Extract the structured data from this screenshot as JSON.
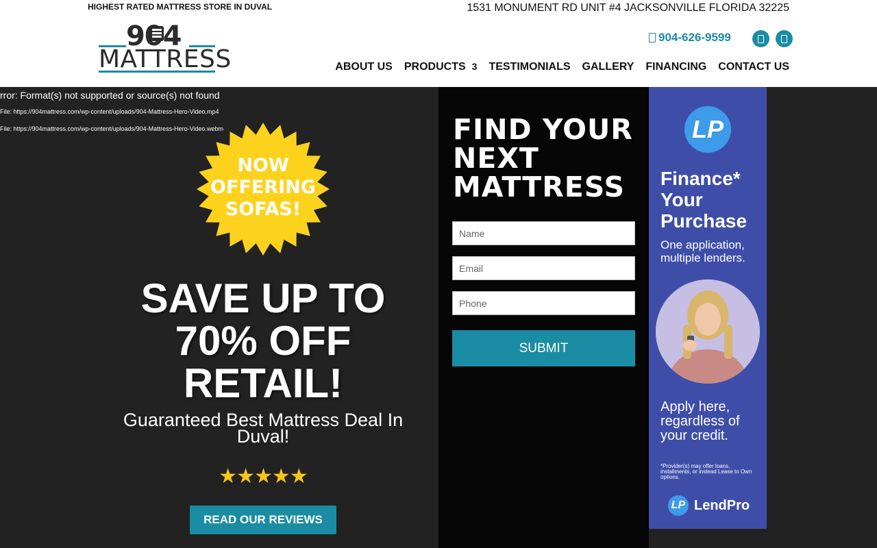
{
  "header": {
    "tagline": "HIGHEST RATED MATTRESS STORE IN DUVAL",
    "address": "1531 MONUMENT RD UNIT #4 JACKSONVILLE FLORIDA 32225",
    "logo": {
      "number": "904",
      "word": "MATTRESS"
    },
    "phone": "904-626-9599",
    "nav": [
      {
        "label": "ABOUT US"
      },
      {
        "label": "PRODUCTS",
        "suffix": "3"
      },
      {
        "label": "TESTIMONIALS"
      },
      {
        "label": "GALLERY"
      },
      {
        "label": "FINANCING"
      },
      {
        "label": "CONTACT US"
      }
    ],
    "social_icons": [
      "facebook-icon",
      "instagram-icon"
    ]
  },
  "hero": {
    "video_error": "rror: Format(s) not supported or source(s) not found",
    "video_files": [
      "File: https://904mattress.com/wp-content/uploads/904-Mattress-Hero-Video.mp4",
      "File: https://904mattress.com/wp-content/uploads/904-Mattress-Hero-Video.webm"
    ],
    "badge_lines": [
      "NOW",
      "OFFERING",
      "SOFAS!"
    ],
    "headline_lines": [
      "SAVE UP TO",
      "70% OFF",
      "RETAIL!"
    ],
    "subheadline": "Guaranteed Best Mattress Deal In Duval!",
    "stars": "★★★★★",
    "reviews_button": "READ OUR REVIEWS"
  },
  "form": {
    "title": "FIND YOUR NEXT MATTRESS",
    "name_placeholder": "Name",
    "email_placeholder": "Email",
    "phone_placeholder": "Phone",
    "submit_label": "SUBMIT"
  },
  "ad": {
    "headline": "Finance* Your Purchase",
    "subline": "One application, multiple lenders.",
    "apply": "Apply here, regardless of your credit.",
    "fine_print": "*Provider(s) may offer loans, installments, or instead Lease to Own options.",
    "brand": "LendPro"
  },
  "colors": {
    "accent": "#1a8ca3",
    "hero_bg": "#222222",
    "form_bg": "#060606",
    "ad_bg": "#3e4ea8",
    "badge": "#fcd21d",
    "stars": "#f5c518"
  }
}
